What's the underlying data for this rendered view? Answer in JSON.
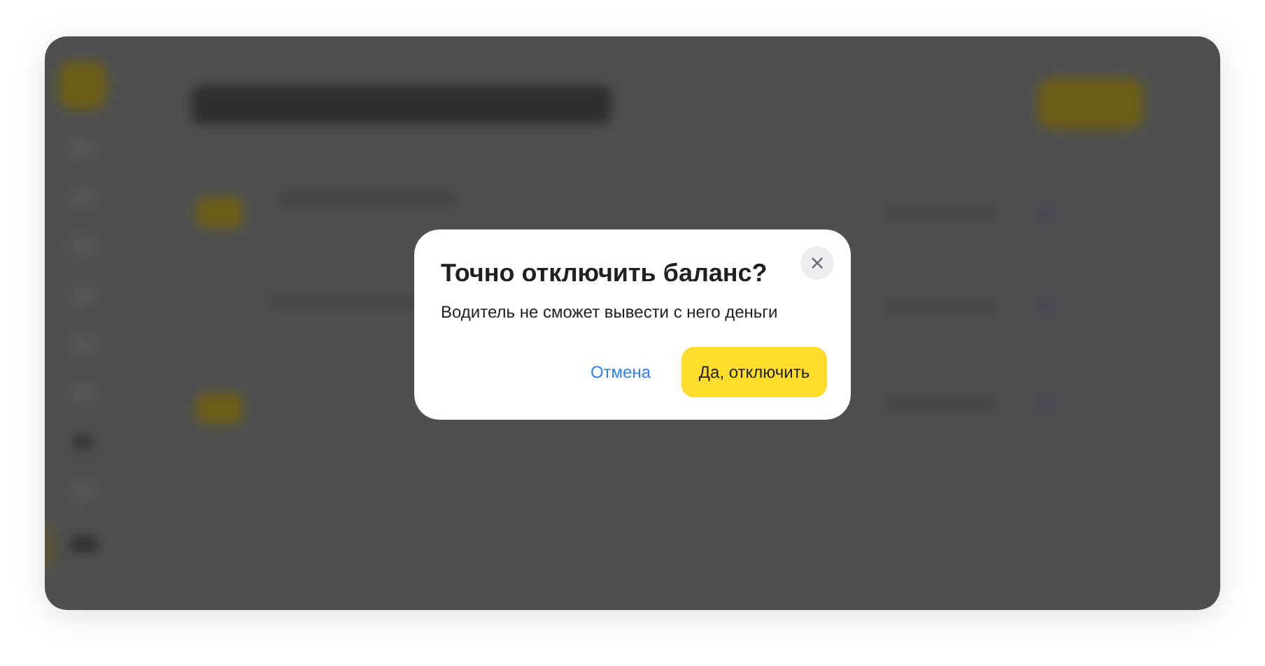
{
  "dialog": {
    "title": "Точно отключить баланс?",
    "close": "×",
    "message": "Водитель не сможет вывести с него деньги",
    "buttons": [
      {
        "label": "Отмена",
        "kind": "link"
      },
      {
        "label": "Да, отключить",
        "kind": "primary"
      }
    ]
  }
}
